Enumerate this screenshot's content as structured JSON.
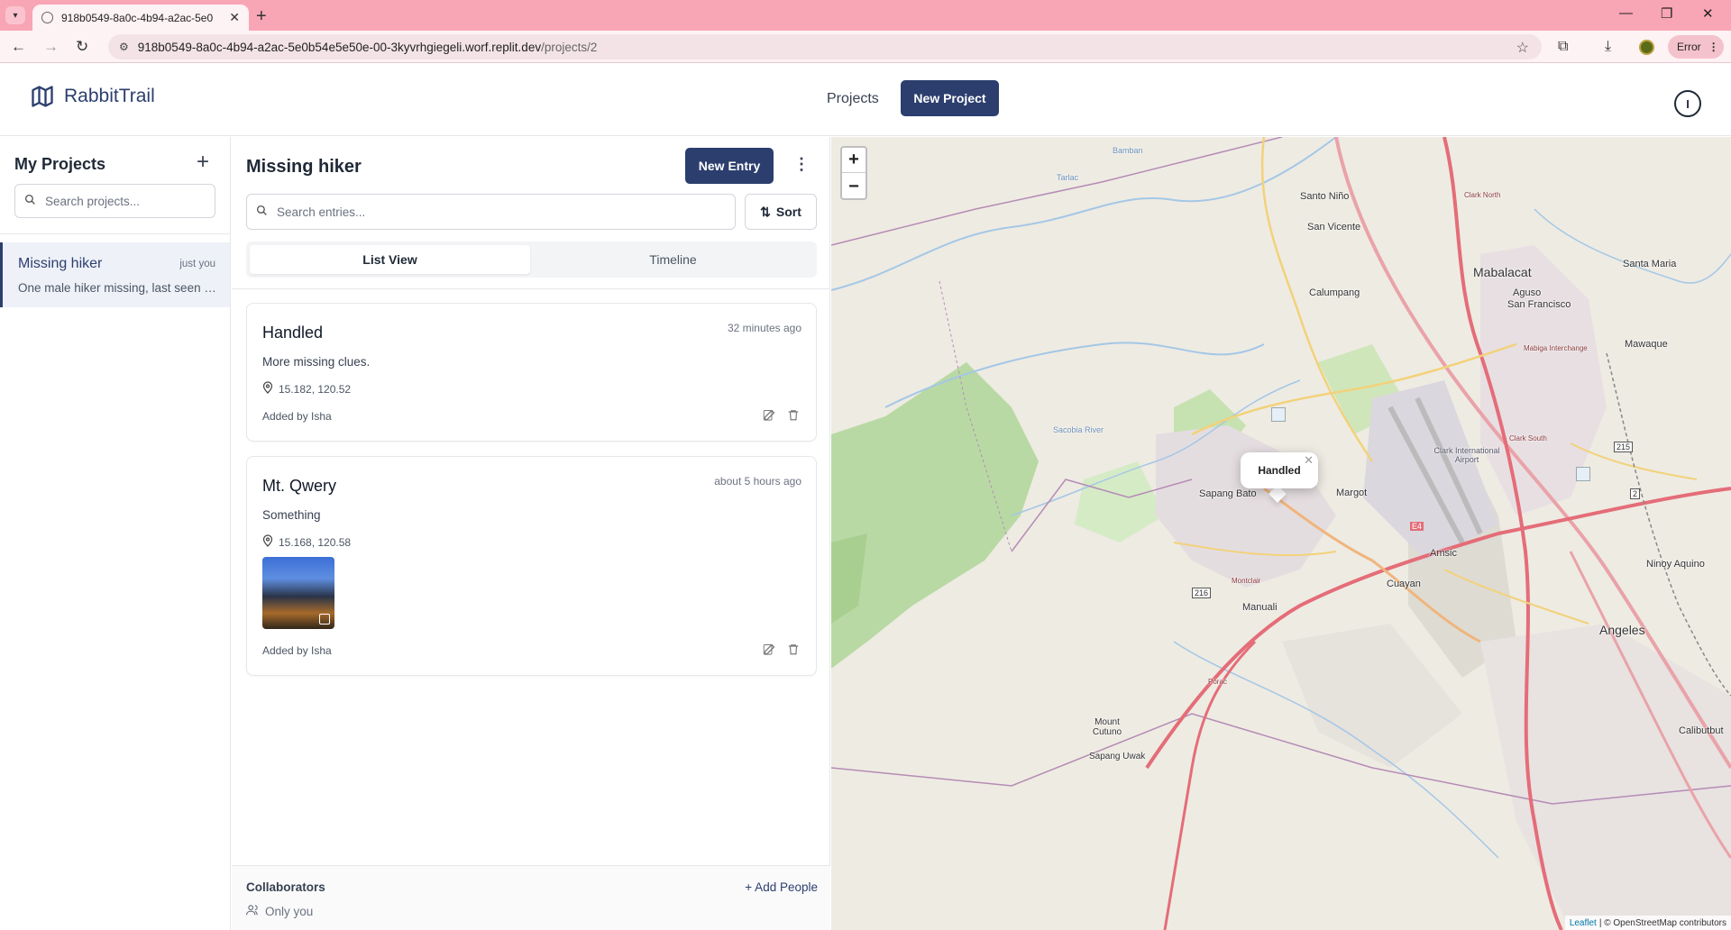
{
  "browser": {
    "tab_title": "918b0549-8a0c-4b94-a2ac-5e0",
    "url_host": "918b0549-8a0c-4b94-a2ac-5e0b54e5e50e-00-3kyvrhgiegeli.worf.replit.dev",
    "url_path": "/projects/2",
    "error_label": "Error"
  },
  "header": {
    "brand": "RabbitTrail",
    "nav_projects": "Projects",
    "new_project": "New Project",
    "user_initial": "I"
  },
  "sidebar": {
    "title": "My Projects",
    "search_placeholder": "Search projects...",
    "projects": [
      {
        "name": "Missing hiker",
        "time": "just you",
        "desc": "One male hiker missing, last seen near the trail"
      }
    ]
  },
  "entries": {
    "title": "Missing hiker",
    "new_entry": "New Entry",
    "search_placeholder": "Search entries...",
    "sort": "Sort",
    "tabs": {
      "list": "List View",
      "timeline": "Timeline"
    },
    "items": [
      {
        "title": "Handled",
        "time": "32 minutes ago",
        "desc": "More missing clues.",
        "coords": "15.182, 120.52",
        "added_by": "Added by Isha"
      },
      {
        "title": "Mt. Qwery",
        "time": "about 5 hours ago",
        "desc": "Something",
        "coords": "15.168, 120.58",
        "added_by": "Added by Isha"
      }
    ],
    "collaborators": {
      "title": "Collaborators",
      "add": "+ Add People",
      "only_you": "Only you"
    }
  },
  "map": {
    "zoom_in": "+",
    "zoom_out": "−",
    "popup": "Handled",
    "attribution_leaflet": "Leaflet",
    "attribution_rest": "| © OpenStreetMap contributors",
    "labels": {
      "santo_nino": "Santo Niño",
      "san_vicente": "San Vicente",
      "calumpang": "Calumpang",
      "mabalacat": "Mabalacat",
      "santa_maria": "Santa Maria",
      "aguso": "Aguso",
      "san_francisco": "San Francisco",
      "mawaque": "Mawaque",
      "clark_airport": "Clark International Airport",
      "sapang_bato": "Sapang Bato",
      "margot": "Margot",
      "amsic": "Amsic",
      "ninoy_aquino": "Ninoy Aquino",
      "cuayan": "Cuayan",
      "manuali": "Manuali",
      "angeles": "Angeles",
      "mount_cutuno": "Mount Cutuno",
      "calibutbut": "Calibutbut",
      "sapang_uwak": "Sapang Uwak",
      "clark_north": "Clark North",
      "clark_south": "Clark South",
      "mabiga": "Mabiga Interchange",
      "bamban": "Bamban",
      "tarlac": "Tarlac",
      "sacobia": "Sacobia River",
      "montclair": "Montclair",
      "porac": "Porac",
      "e4": "E4",
      "r215": "215",
      "r216": "216",
      "r2": "2"
    }
  }
}
